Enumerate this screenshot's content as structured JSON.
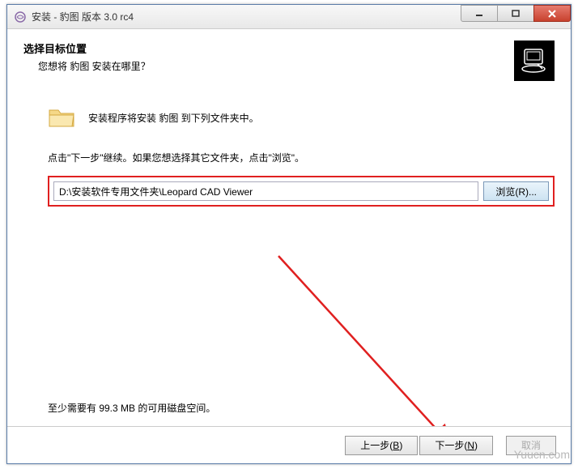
{
  "titlebar": {
    "text": "安装 - 豹图 版本 3.0 rc4"
  },
  "header": {
    "title": "选择目标位置",
    "subtitle": "您想将 豹图 安装在哪里？"
  },
  "body": {
    "install_text": "安装程序将安装 豹图 到下列文件夹中。",
    "instruction": "点击\"下一步\"继续。如果您想选择其它文件夹，点击\"浏览\"。",
    "path_value": "D:\\安装软件专用文件夹\\Leopard CAD Viewer",
    "browse_label": "浏览(R)...",
    "disk_space": "至少需要有 99.3 MB 的可用磁盘空间。"
  },
  "footer": {
    "back_label": "上一步(B)",
    "back_key": "B",
    "next_label": "下一步(N)",
    "next_key": "N",
    "cancel_label": "取消"
  },
  "watermark": "Yuucn.com"
}
